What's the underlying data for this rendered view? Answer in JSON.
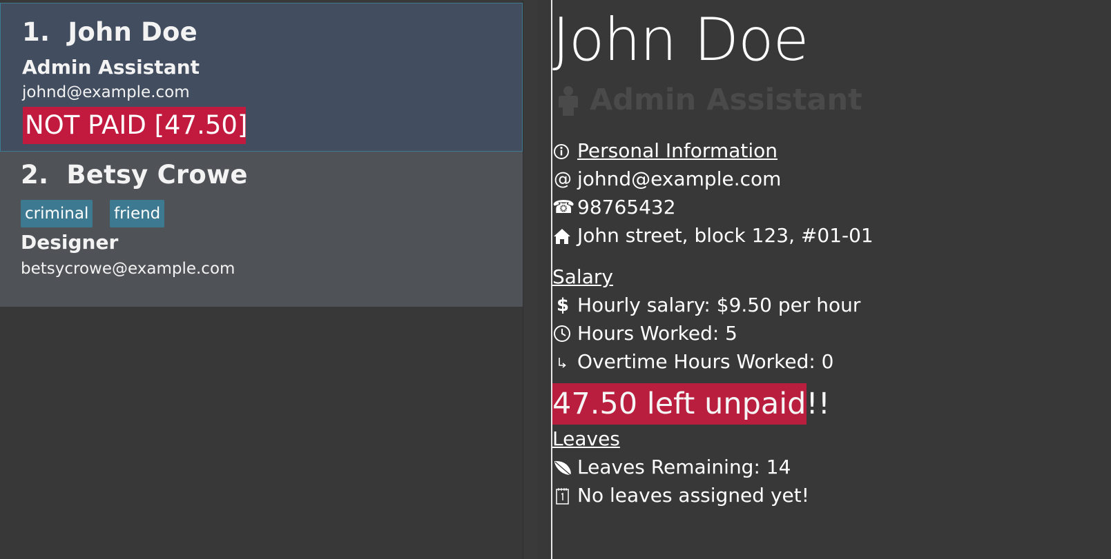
{
  "persons": [
    {
      "index": "1.",
      "name": "John Doe",
      "role": "Admin Assistant",
      "email": "johnd@example.com",
      "pay_status": "NOT PAID [47.50]",
      "tags": []
    },
    {
      "index": "2.",
      "name": "Betsy Crowe",
      "role": "Designer",
      "email": "betsycrowe@example.com",
      "tags": [
        "criminal",
        "friend"
      ]
    }
  ],
  "detail": {
    "name": "John Doe",
    "role": "Admin Assistant",
    "personal_header": "Personal Information",
    "email": "johnd@example.com",
    "phone": "98765432",
    "address": "John street, block 123, #01-01",
    "salary_header": "Salary",
    "hourly_salary": "Hourly salary: $9.50 per hour",
    "hours_worked": "Hours Worked: 5",
    "overtime_hours": "Overtime Hours Worked: 0",
    "unpaid_text": "47.50 left unpaid!!",
    "leaves_header": "Leaves",
    "leaves_remaining": "Leaves Remaining: 14",
    "leaves_assigned": "No leaves assigned yet!"
  },
  "icons": {
    "info": "info-icon",
    "email": "at-icon",
    "phone": "phone-icon",
    "address": "home-icon",
    "salary": "dollar-icon",
    "hours": "clock-icon",
    "overtime": "overtime-arrow-icon",
    "leaves": "leaf-icon",
    "calendar": "calendar-icon",
    "role": "person-icon"
  },
  "colors": {
    "background": "#383838",
    "selected_card": "#424d5f",
    "card": "#4f5357",
    "tag": "#3d7a91",
    "unpaid": "#c21a3f"
  }
}
